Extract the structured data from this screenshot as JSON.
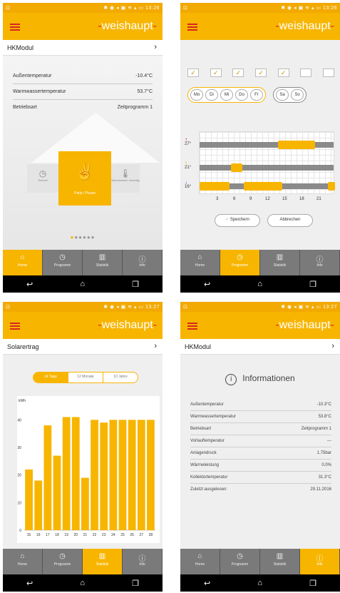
{
  "app": {
    "brand": "weishaupt"
  },
  "screens": [
    {
      "time": "13:26",
      "title": "HKModul",
      "info": [
        {
          "label": "Außentemperatur",
          "value": "-10.4°C"
        },
        {
          "label": "Warmwassertemperatur",
          "value": "53.7°C"
        },
        {
          "label": "Betriebsart",
          "value": "Zeitprogramm 1"
        }
      ],
      "modes": {
        "center": "Party / Pause",
        "left": "Schnell",
        "right": "Warmwasser einmalig"
      }
    },
    {
      "time": "13:26",
      "weekdays": [
        "Mo",
        "Di",
        "Mi",
        "Do",
        "Fr"
      ],
      "weekend": [
        "Sa",
        "So"
      ],
      "temps": [
        "27°",
        "21°",
        "16°"
      ],
      "hours": [
        "3",
        "6",
        "9",
        "12",
        "15",
        "18",
        "21"
      ],
      "save": "Speichern",
      "cancel": "Abbrechen"
    },
    {
      "time": "13:27",
      "title": "Solarertrag",
      "ranges": [
        "14 Tage",
        "12 Monate",
        "10 Jahre"
      ]
    },
    {
      "time": "13:27",
      "title": "HKModul",
      "heading": "Informationen",
      "info": [
        {
          "label": "Außentemperatur",
          "value": "-10.3°C"
        },
        {
          "label": "Warmwassertemperatur",
          "value": "53.8°C"
        },
        {
          "label": "Betriebsart",
          "value": "Zeitprogramm 1"
        },
        {
          "label": "Vorlauftemperatur",
          "value": "---"
        },
        {
          "label": "Anlagendruck",
          "value": "1.75bar"
        },
        {
          "label": "Wärmeleistung",
          "value": "0.0%"
        },
        {
          "label": "Kollektortemperatur",
          "value": "31.3°C"
        },
        {
          "label": "Zuletzt ausgelesen:",
          "value": "29.11.2016"
        }
      ]
    }
  ],
  "nav": [
    "Home",
    "Programm",
    "Statistik",
    "Info"
  ],
  "chart_data": {
    "type": "bar",
    "ylabel": "kWh",
    "categories": [
      "15",
      "16",
      "17",
      "18",
      "19",
      "20",
      "21",
      "22",
      "23",
      "24",
      "25",
      "26",
      "27",
      "28"
    ],
    "values": [
      22,
      18,
      38,
      27,
      41,
      41,
      19,
      40,
      39,
      40,
      40,
      40,
      40,
      40
    ],
    "ylim": [
      0,
      45
    ],
    "yticks": [
      0,
      10,
      20,
      30,
      40
    ],
    "color": "#f7b500"
  }
}
